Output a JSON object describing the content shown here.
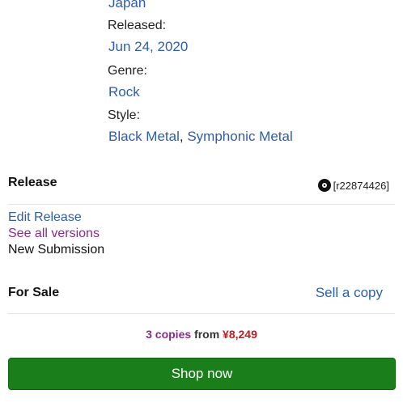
{
  "details": {
    "country_value": "Japan",
    "released_label": "Released:",
    "released_value": "Jun 24, 2020",
    "genre_label": "Genre:",
    "genre_value": "Rock",
    "style_label": "Style:",
    "style_values": [
      "Black Metal",
      "Symphonic Metal"
    ],
    "style_separator": ","
  },
  "release": {
    "title": "Release",
    "id": "[r22874426]",
    "icon": "disc-icon",
    "links": {
      "edit": "Edit Release",
      "versions": "See all versions",
      "new_submission": "New Submission"
    }
  },
  "for_sale": {
    "title": "For Sale",
    "sell_link": "Sell a copy",
    "copies": "3 copies",
    "from_text": "from",
    "price": "¥8,249",
    "shop_button": "Shop now"
  },
  "colors": {
    "link_blue": "#2e5eaa",
    "visited_purple": "#8a2a8a",
    "price_red": "#c41c1c",
    "button_green": "#1a7f1a"
  }
}
